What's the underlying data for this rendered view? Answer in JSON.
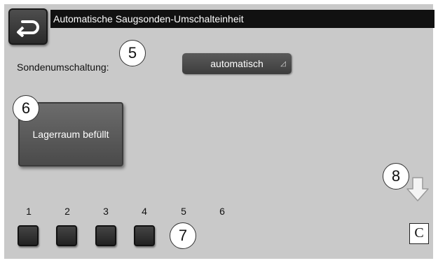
{
  "header": {
    "title": "Automatische Saugsonden-Umschalteinheit",
    "back_icon": "return-arrow-icon"
  },
  "settings": {
    "switching_label": "Sondenumschaltung:",
    "switching_value": "automatisch"
  },
  "actions": {
    "storage_filled_label": "Lagerraum befüllt",
    "reset_label": "C"
  },
  "probes": {
    "numbers": [
      "1",
      "2",
      "3",
      "4",
      "5",
      "6"
    ]
  },
  "callouts": {
    "five": "5",
    "six": "6",
    "seven": "7",
    "eight": "8"
  },
  "colors": {
    "background": "#c9c9c9",
    "button": "#4a4a4a",
    "title_bar": "#111111"
  }
}
